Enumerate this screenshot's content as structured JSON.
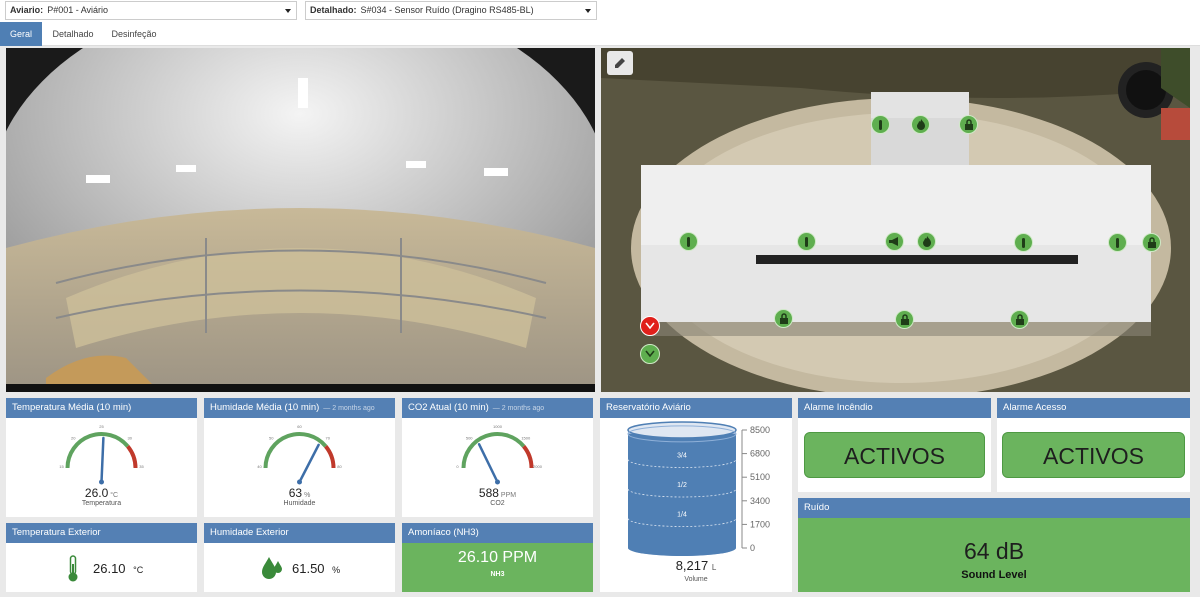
{
  "selectors": {
    "aviario_label": "Aviario:",
    "aviario_value": "P#001 - Aviário",
    "detalhado_label": "Detalhado:",
    "detalhado_value": "S#034 - Sensor Ruído (Dragino RS485-BL)"
  },
  "tabs": [
    {
      "label": "Geral",
      "active": true
    },
    {
      "label": "Detalhado",
      "active": false
    },
    {
      "label": "Desinfeção",
      "active": false
    }
  ],
  "cards": {
    "temp_media": {
      "title": "Temperatura Média (10 min)",
      "value": "26.0",
      "unit": "°C",
      "label": "Temperatura",
      "ticks": [
        "15",
        "20",
        "25",
        "30",
        "35"
      ],
      "level": 0.52
    },
    "humidade_media": {
      "title": "Humidade Média (10 min)",
      "ago": "— 2 months ago",
      "value": "63",
      "unit": "%",
      "label": "Humidade",
      "ticks": [
        "40",
        "50",
        "60",
        "70",
        "80"
      ],
      "level": 0.72
    },
    "co2": {
      "title": "CO2 Atual (10 min)",
      "ago": "— 2 months ago",
      "value": "588",
      "unit": "PPM",
      "label": "CO2",
      "ticks": [
        "0",
        "500",
        "1000",
        "1500",
        "2000"
      ],
      "level": 0.29
    },
    "reservatorio": {
      "title": "Reservatório Aviário",
      "scale": [
        "8500",
        "6800",
        "5100",
        "3400",
        "1700",
        "0"
      ],
      "fractions": [
        "3/4",
        "1/2",
        "1/4"
      ],
      "value": "8,217",
      "unit": "L",
      "label": "Volume",
      "level": 0.967
    },
    "alarme_incendio": {
      "title": "Alarme Incêndio",
      "status": "ACTIVOS"
    },
    "alarme_acesso": {
      "title": "Alarme Acesso",
      "status": "ACTIVOS"
    },
    "temp_exterior": {
      "title": "Temperatura Exterior",
      "value": "26.10",
      "unit": "°C",
      "icon": "thermometer-icon"
    },
    "humidade_exterior": {
      "title": "Humidade Exterior",
      "value": "61.50",
      "unit": "%",
      "icon": "droplets-icon"
    },
    "amoniaco": {
      "title": "Amoníaco (NH3)",
      "value": "26.10 PPM",
      "label": "NH3"
    },
    "ruido": {
      "title": "Ruído",
      "value": "64 dB",
      "label": "Sound Level"
    }
  },
  "colors": {
    "header_blue": "#5480b4",
    "tab_active": "#4f7fb4",
    "status_green": "#6bb45e",
    "gauge_red": "#c0392b",
    "tank_blue": "#4f7fb4"
  },
  "map_icons": [
    "thermometer-icon",
    "fire-icon",
    "lock-icon",
    "megaphone-icon",
    "add-user-icon",
    "chevron-down-icon",
    "edit-icon"
  ]
}
